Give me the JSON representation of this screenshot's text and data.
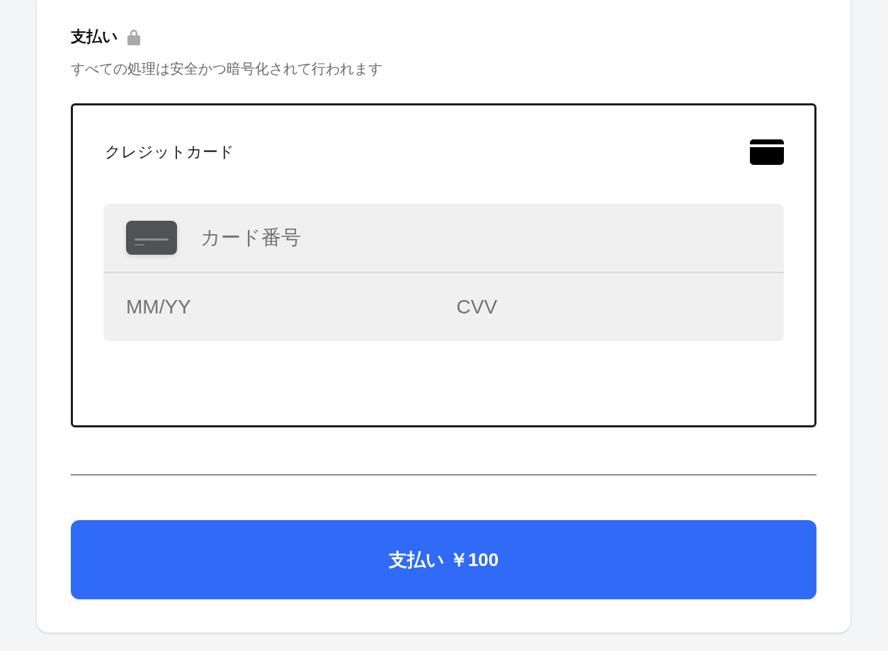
{
  "payment": {
    "title": "支払い",
    "subtitle": "すべての処理は安全かつ暗号化されて行われます"
  },
  "methods": [
    {
      "label": "クレジットカード",
      "selected": true,
      "card_number": {
        "placeholder": "カード番号"
      },
      "expiry": {
        "placeholder": "MM/YY"
      },
      "cvv": {
        "placeholder": "CVV"
      }
    }
  ],
  "pay_button": {
    "label": "支払い ￥100"
  }
}
